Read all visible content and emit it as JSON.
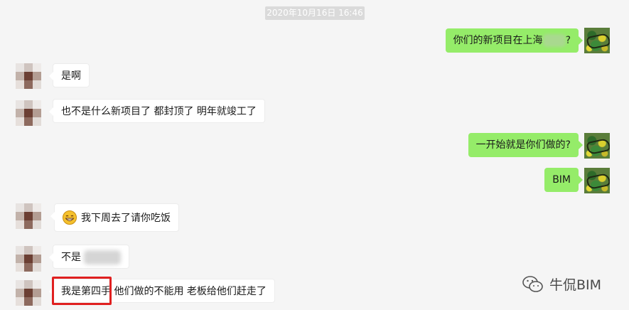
{
  "timestamp": "2020年10月16日 16:46",
  "messages": [
    {
      "side": "out",
      "text_before": "你们的新项目在上海",
      "text_after": "?"
    },
    {
      "side": "in",
      "text": "是啊"
    },
    {
      "side": "in",
      "text": "也不是什么新项目了 都封顶了 明年就竣工了"
    },
    {
      "side": "out",
      "text": "一开始就是你们做的?"
    },
    {
      "side": "out",
      "text": "BIM"
    },
    {
      "side": "in",
      "text": "我下周去了请你吃饭",
      "emoji": "grinning-face-emoji"
    },
    {
      "side": "in",
      "text": "不是"
    },
    {
      "side": "in",
      "text_highlight": "我是第四手",
      "text_rest": " 他们做的不能用 老板给他们赶走了"
    }
  ],
  "watermark": "牛侃BIM",
  "colors": {
    "background": "#f5f5f5",
    "outgoing_bubble": "#95ec69",
    "incoming_bubble": "#ffffff",
    "highlight_border": "#e02020"
  }
}
